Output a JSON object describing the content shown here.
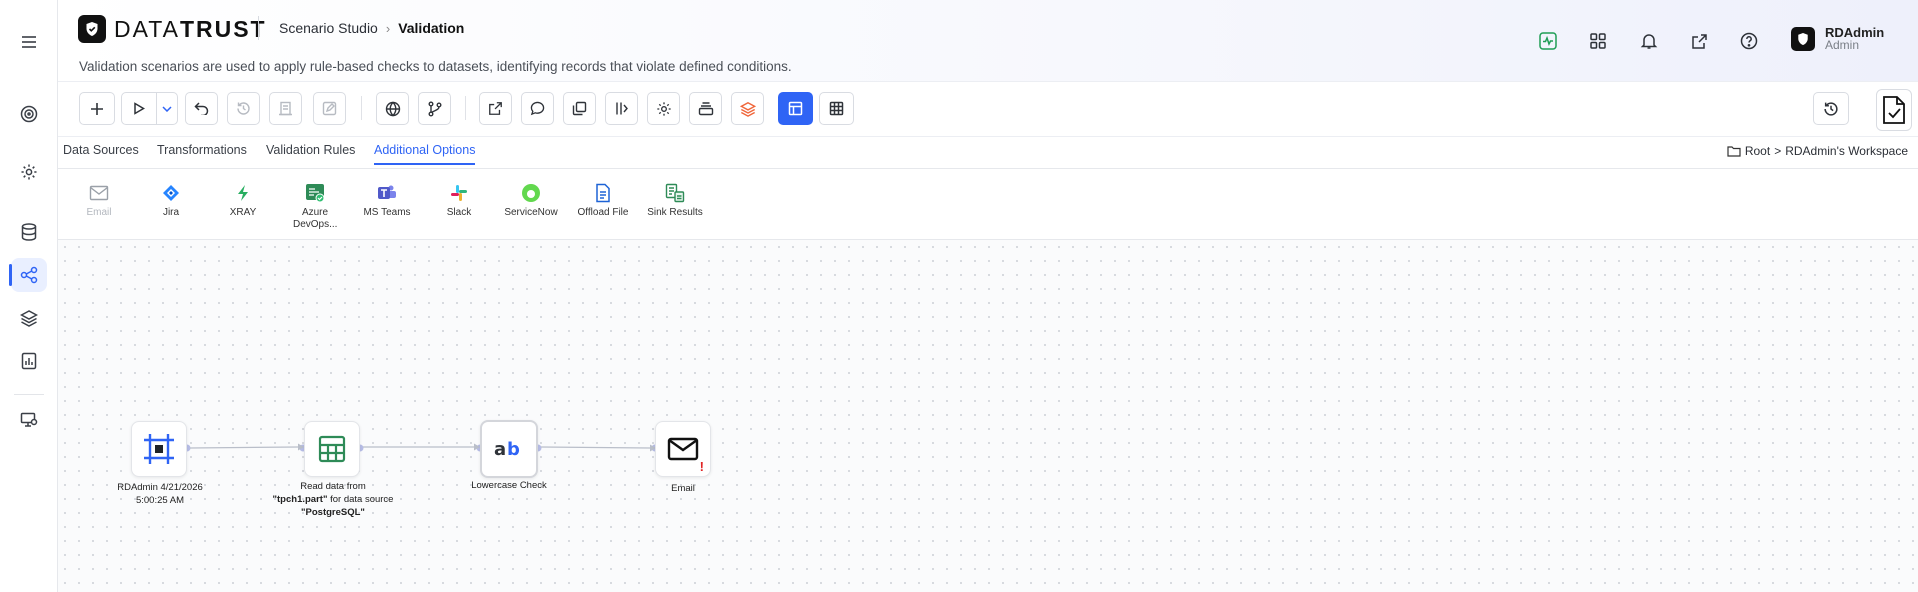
{
  "app": {
    "brand_light": "DATA",
    "brand_bold": "TRUST"
  },
  "breadcrumb": {
    "parent": "Scenario Studio",
    "current": "Validation"
  },
  "subtitle": "Validation scenarios are used to apply rule-based checks to datasets, identifying records that violate defined conditions.",
  "user": {
    "name": "RDAdmin",
    "role": "Admin"
  },
  "tabs": [
    {
      "label": "Data Sources",
      "active": false
    },
    {
      "label": "Transformations",
      "active": false
    },
    {
      "label": "Validation Rules",
      "active": false
    },
    {
      "label": "Additional Options",
      "active": true
    }
  ],
  "workspace_path": {
    "root": "Root",
    "separator": ">",
    "workspace": "RDAdmin's Workspace"
  },
  "palette": [
    {
      "label": "Email",
      "icon": "mail-icon",
      "disabled": true
    },
    {
      "label": "Jira",
      "icon": "jira-icon",
      "disabled": false
    },
    {
      "label": "XRAY",
      "icon": "xray-icon",
      "disabled": false
    },
    {
      "label": "Azure DevOps...",
      "icon": "azure-devops-icon",
      "disabled": false
    },
    {
      "label": "MS Teams",
      "icon": "ms-teams-icon",
      "disabled": false
    },
    {
      "label": "Slack",
      "icon": "slack-icon",
      "disabled": false
    },
    {
      "label": "ServiceNow",
      "icon": "servicenow-icon",
      "disabled": false
    },
    {
      "label": "Offload File",
      "icon": "offload-file-icon",
      "disabled": false
    },
    {
      "label": "Sink Results",
      "icon": "sink-results-icon",
      "disabled": false
    }
  ],
  "nodes": {
    "start": {
      "label": "RDAdmin 4/21/2026 5:00:25 AM"
    },
    "read": {
      "label_prefix": "Read data from ",
      "table": "\"tpch1.part\"",
      "label_mid": " for data source ",
      "source": "\"PostgreSQL\""
    },
    "check": {
      "label": "Lowercase Check",
      "glyph": "ab"
    },
    "email": {
      "label": "Email",
      "warning": "!"
    }
  },
  "colors": {
    "accent": "#2f64f5",
    "header_grad_end": "#eef0fb",
    "warning": "#e02424"
  }
}
